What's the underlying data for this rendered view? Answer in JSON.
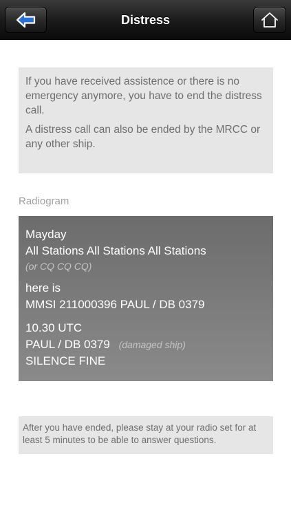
{
  "navbar": {
    "title": "Distress",
    "back_icon": "back-arrow-icon",
    "home_icon": "home-icon"
  },
  "info": {
    "paragraphs": [
      "If you have received assistence or there is no emergency anymore, you have to end the distress call.",
      "A distress call can also be ended by the MRCC or any other ship."
    ]
  },
  "radiogram": {
    "label": "Radiogram",
    "mayday": "Mayday",
    "all_stations": "All Stations All Stations All Stations",
    "or_cq": "(or CQ CQ CQ)",
    "here_is": "here is",
    "mmsi_line": "MMSI 211000396 PAUL / DB 0379",
    "time": "10.30 UTC",
    "ship": "PAUL / DB 0379",
    "ship_note": "(damaged ship)",
    "silence": "SILENCE FINE"
  },
  "footer": {
    "text": "After you have ended, please stay at your radio set for at least 5 minutes to be able to answer questions."
  },
  "colors": {
    "navbar": "#1c1c1c",
    "info_bg": "#e6e6e6",
    "radiogram_bg": "#7a7a7a"
  }
}
